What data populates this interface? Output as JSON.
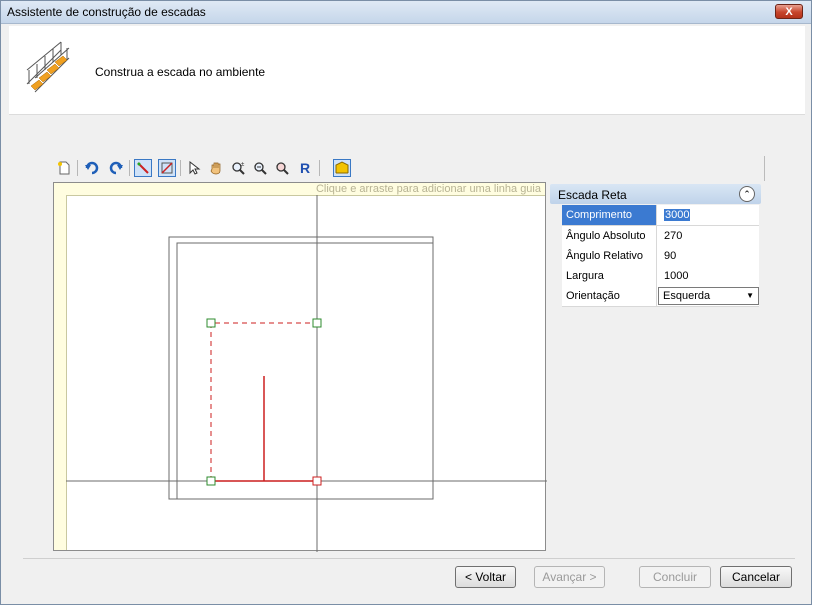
{
  "window": {
    "title": "Assistente de construção de escadas",
    "close_label": "X"
  },
  "header": {
    "icon": "staircase-icon",
    "instruction": "Construa a escada no ambiente"
  },
  "toolbar": {
    "buttons": [
      "new-icon",
      "undo-icon",
      "redo-icon",
      "draw-stair-icon",
      "edit-stair-icon",
      "select-arrow-icon",
      "pan-hand-icon",
      "zoom-in-out-icon",
      "zoom-window-icon",
      "zoom-extents-icon",
      "redraw-icon",
      "view-3d-icon"
    ]
  },
  "canvas": {
    "hint": "Clique e arraste para adicionar uma linha guia"
  },
  "properties": {
    "title": "Escada Reta",
    "collapse_icon": "chevron-up-double-icon",
    "rows": [
      {
        "label": "Comprimento",
        "value": "3000"
      },
      {
        "label": "Ângulo Absoluto",
        "value": "270"
      },
      {
        "label": "Ângulo Relativo",
        "value": "90"
      },
      {
        "label": "Largura",
        "value": "1000"
      },
      {
        "label": "Orientação",
        "value": "Esquerda"
      }
    ],
    "selected_row": 0
  },
  "footer": {
    "back_label": "< Voltar",
    "next_label": "Avançar >",
    "finish_label": "Concluir",
    "cancel_label": "Cancelar"
  },
  "colors": {
    "accent": "#3b7ad1",
    "stair_line": "#cc1f1f",
    "handle": "#2e8b2e"
  }
}
